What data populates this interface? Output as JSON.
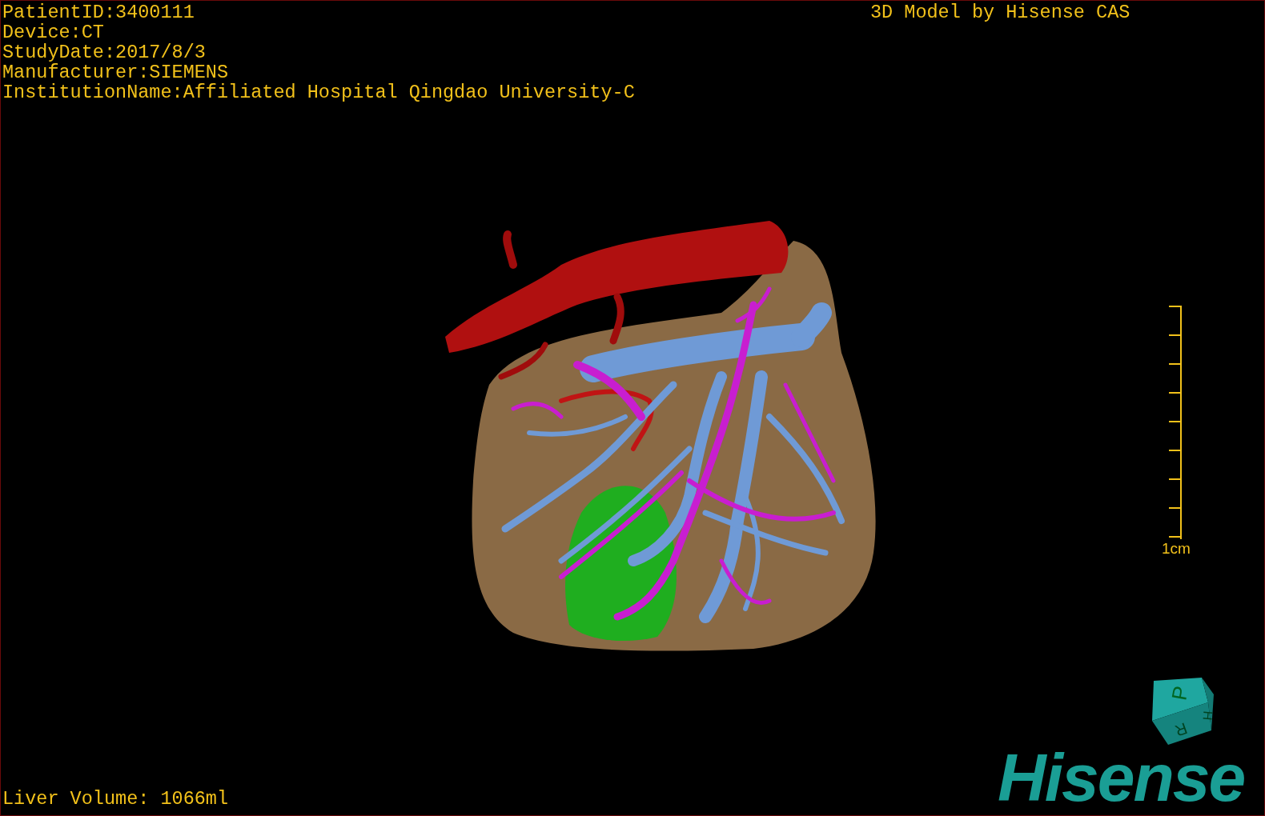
{
  "info_lines": [
    "PatientID:3400111",
    "Device:CT",
    "StudyDate:2017/8/3",
    "Manufacturer:SIEMENS",
    "InstitutionName:Affiliated Hospital Qingdao University-C"
  ],
  "title": "3D Model by Hisense CAS",
  "scale_bar": {
    "label": "1cm"
  },
  "orientation_cube": {
    "faces": [
      "P",
      "H",
      "R"
    ]
  },
  "logo": "Hisense",
  "measurement": "Liver Volume: 1066ml"
}
